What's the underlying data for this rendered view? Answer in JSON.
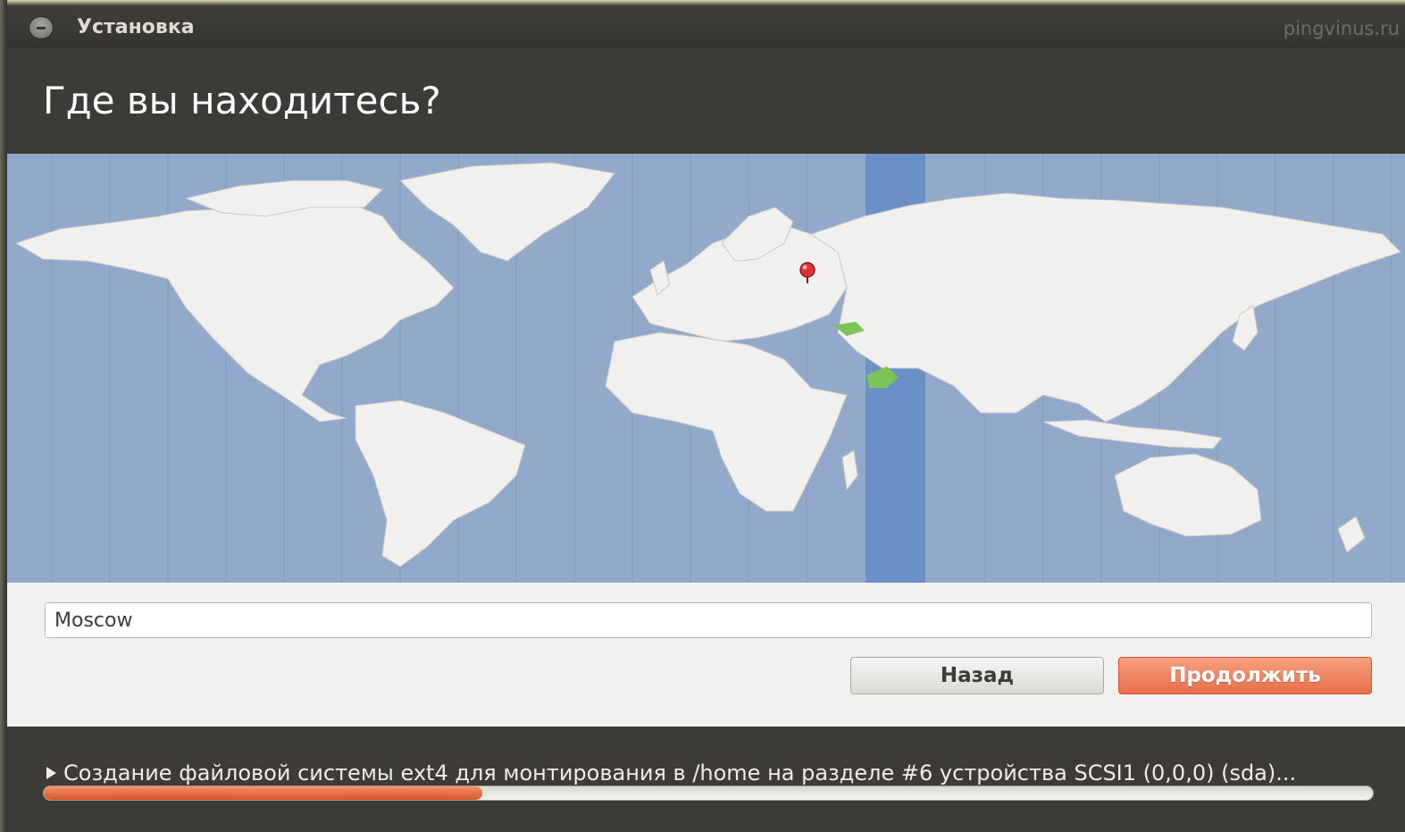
{
  "window": {
    "title": "Установка",
    "watermark": "pingvinus.ru"
  },
  "header": {
    "page_title": "Где вы находитесь?"
  },
  "map": {
    "selected_city_marker": "map-pin-icon",
    "ocean_color": "#93a9cc",
    "land_color": "#f1f0ee",
    "selected_zone_color": "#6b90c8",
    "highlight_color": "#7cc35a"
  },
  "location": {
    "value": "Moscow"
  },
  "buttons": {
    "back_label": "Назад",
    "continue_label": "Продолжить"
  },
  "footer": {
    "status_text": "Создание файловой системы ext4 для монтирования в /home на разделе #6 устройства SCSI1 (0,0,0) (sda)...",
    "progress_fraction": 0.33,
    "expander_icon": "triangle-right-icon"
  },
  "colors": {
    "accent": "#e96f48",
    "dark_bg": "#3c3b37"
  }
}
